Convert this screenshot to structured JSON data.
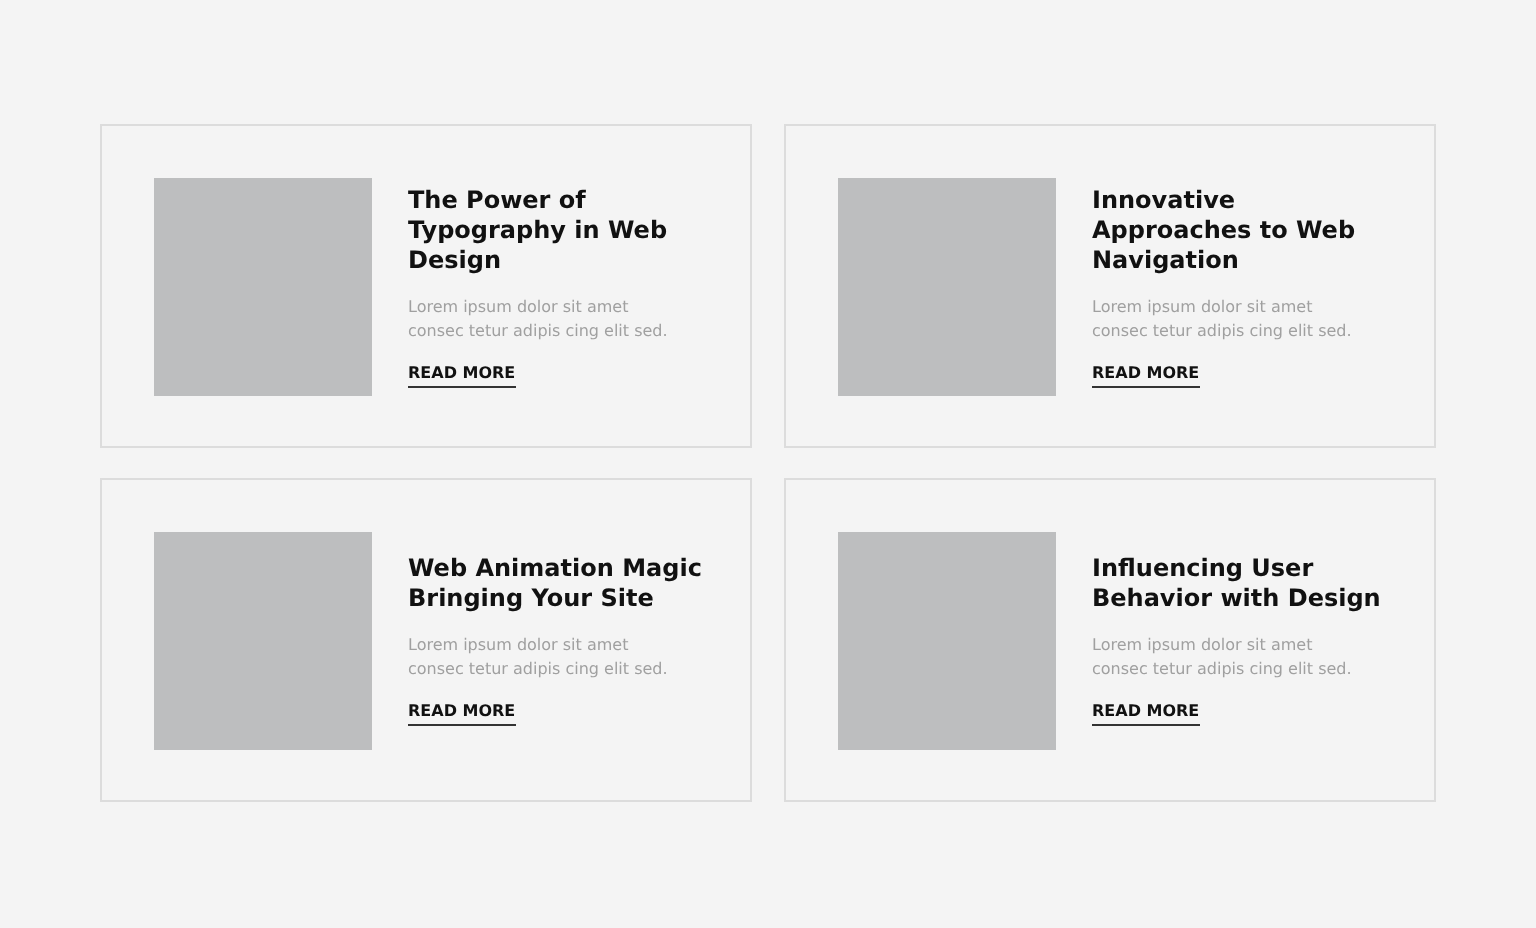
{
  "cards": [
    {
      "title": "The Power of Typography in Web Design",
      "excerpt": "Lorem ipsum dolor sit amet consec tetur adipis cing elit sed.",
      "link": "READ MORE"
    },
    {
      "title": "Innovative Approaches to Web Navigation",
      "excerpt": "Lorem ipsum dolor sit amet consec tetur adipis cing elit sed.",
      "link": "READ MORE"
    },
    {
      "title": "Web Animation Magic Bringing Your Site",
      "excerpt": "Lorem ipsum dolor sit amet consec tetur adipis cing elit sed.",
      "link": "READ MORE"
    },
    {
      "title": "Influencing User Behavior with Design",
      "excerpt": "Lorem ipsum dolor sit amet consec tetur adipis cing elit sed.",
      "link": "READ MORE"
    }
  ]
}
